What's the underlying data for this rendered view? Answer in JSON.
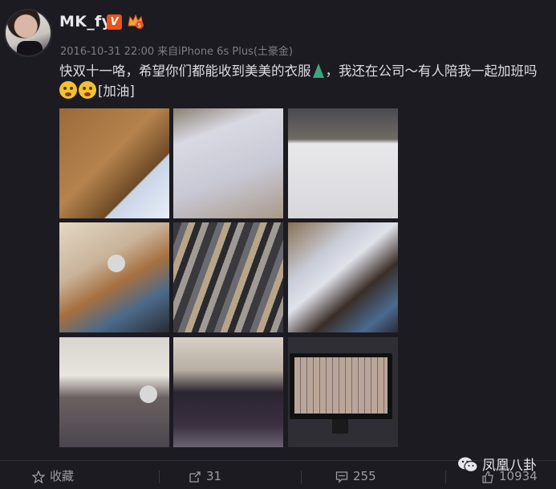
{
  "user": {
    "name": "MK_fy",
    "verified_badge": "V"
  },
  "post": {
    "date": "2016-10-31 22:00",
    "via_prefix": "来自",
    "device": "iPhone 6s Plus(土豪金)",
    "text_part1": "快双十一咯，希望你们都能收到美美的衣服",
    "text_part2": "，我还在公司～有人陪我一起加班吗",
    "text_tag": "[加油]"
  },
  "actions": {
    "favorite_label": "收藏",
    "repost_count": "31",
    "comment_count": "255",
    "like_count": "10934"
  },
  "watermark": {
    "label": "凤凰八卦"
  },
  "colors": {
    "background": "#1c1b22",
    "verified": "#e8551c"
  }
}
